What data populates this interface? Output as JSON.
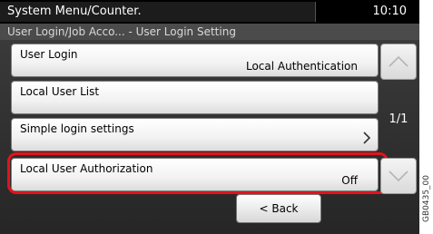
{
  "header": {
    "title": "System Menu/Counter.",
    "time": "10:10"
  },
  "breadcrumb": "User Login/Job Acco... - User Login Setting",
  "menu": {
    "items": [
      {
        "label": "User Login",
        "value": "Local Authentication"
      },
      {
        "label": "Local User List"
      },
      {
        "label": "Simple login settings"
      },
      {
        "label": "Local User Authorization",
        "value": "Off"
      }
    ]
  },
  "pager": {
    "text": "1/1"
  },
  "footer": {
    "back_label": "< Back"
  },
  "figure_id": "GB0435_00",
  "colors": {
    "highlight": "#e2131d",
    "statusbar": "#000000",
    "breadcrumb_bg": "#4b4b4b"
  }
}
